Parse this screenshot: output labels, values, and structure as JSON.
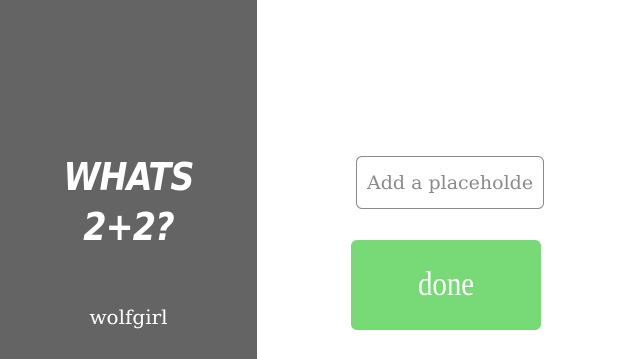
{
  "question_panel": {
    "question_text": "WHATS 2+2?",
    "author": "wolfgirl",
    "background_color": "#646464"
  },
  "answer_panel": {
    "input": {
      "value": "",
      "placeholder": "Add a placeholder"
    },
    "done_button": {
      "label": "done",
      "color": "#77da77"
    }
  }
}
